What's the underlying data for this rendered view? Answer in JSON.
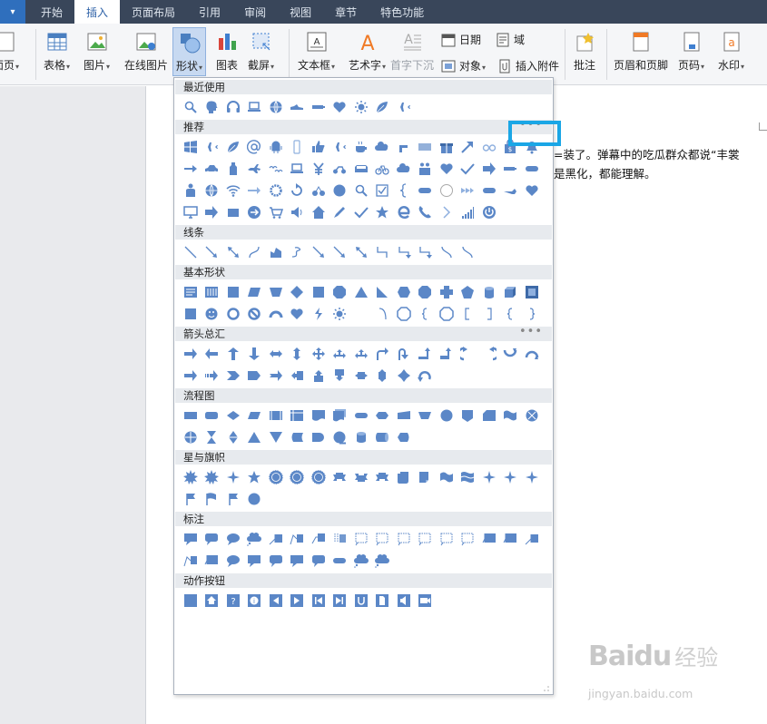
{
  "menubar": {
    "tabs": [
      "开始",
      "插入",
      "页面布局",
      "引用",
      "审阅",
      "视图",
      "章节",
      "特色功能"
    ],
    "active_tab": "插入"
  },
  "ribbon": {
    "cover_page_partial": "面页",
    "table": "表格",
    "picture": "图片",
    "online_picture": "在线图片",
    "shapes": "形状",
    "chart": "图表",
    "screenshot": "截屏",
    "textbox": "文本框",
    "wordart": "艺术字",
    "dropcap": "首字下沉",
    "date": "日期",
    "field": "域",
    "object": "对象",
    "attachment": "插入附件",
    "comment": "批注",
    "header_footer": "页眉和页脚",
    "page_number": "页码",
    "watermark": "水印"
  },
  "document": {
    "line1": "=装了。弹幕中的吃瓜群众都说“丰裳",
    "line2": "是黑化，都能理解。"
  },
  "shapes_panel": {
    "sections": {
      "recent": "最近使用",
      "recommended": "推荐",
      "lines": "线条",
      "basic": "基本形状",
      "arrows": "箭头总汇",
      "flowchart": "流程图",
      "stars": "星与旗帜",
      "callouts": "标注",
      "action": "动作按钮"
    },
    "more_symbol": "•••"
  },
  "watermark": {
    "brand": "Baidu",
    "brand_suffix": "经验",
    "url": "jingyan.baidu.com"
  },
  "colors": {
    "shape_fill": "#5b87c7",
    "highlight": "#1aa6e6",
    "menubar": "#39465a"
  }
}
